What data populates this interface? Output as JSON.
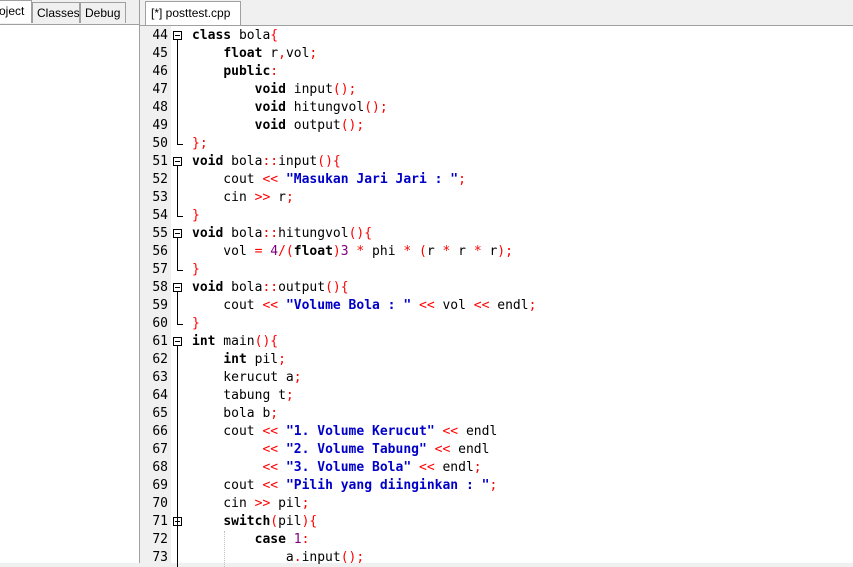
{
  "left_panel": {
    "tabs": [
      {
        "label": "oject",
        "active": true
      },
      {
        "label": "Classes",
        "active": false
      },
      {
        "label": "Debug",
        "active": false
      }
    ]
  },
  "editor": {
    "tab_label": "[*] posttest.cpp",
    "lines": [
      {
        "n": "44",
        "fold": "open",
        "tokens": [
          [
            "kw",
            "class"
          ],
          [
            "t",
            " bola"
          ],
          [
            "s",
            "{"
          ]
        ]
      },
      {
        "n": "45",
        "tokens": [
          [
            "t",
            "    "
          ],
          [
            "kw",
            "float"
          ],
          [
            "t",
            " r"
          ],
          [
            "s",
            ","
          ],
          [
            "t",
            "vol"
          ],
          [
            "s",
            ";"
          ]
        ]
      },
      {
        "n": "46",
        "tokens": [
          [
            "t",
            "    "
          ],
          [
            "kw",
            "public"
          ],
          [
            "s",
            ":"
          ]
        ]
      },
      {
        "n": "47",
        "tokens": [
          [
            "t",
            "        "
          ],
          [
            "kw",
            "void"
          ],
          [
            "t",
            " input"
          ],
          [
            "s",
            "();"
          ]
        ]
      },
      {
        "n": "48",
        "tokens": [
          [
            "t",
            "        "
          ],
          [
            "kw",
            "void"
          ],
          [
            "t",
            " hitungvol"
          ],
          [
            "s",
            "();"
          ]
        ]
      },
      {
        "n": "49",
        "tokens": [
          [
            "t",
            "        "
          ],
          [
            "kw",
            "void"
          ],
          [
            "t",
            " output"
          ],
          [
            "s",
            "();"
          ]
        ]
      },
      {
        "n": "50",
        "fold": "end",
        "tokens": [
          [
            "s",
            "};"
          ]
        ]
      },
      {
        "n": "51",
        "fold": "open",
        "tokens": [
          [
            "kw",
            "void"
          ],
          [
            "t",
            " bola"
          ],
          [
            "s",
            "::"
          ],
          [
            "t",
            "input"
          ],
          [
            "s",
            "(){"
          ]
        ]
      },
      {
        "n": "52",
        "tokens": [
          [
            "t",
            "    cout "
          ],
          [
            "s",
            "<<"
          ],
          [
            "t",
            " "
          ],
          [
            "str",
            "\"Masukan Jari Jari : \""
          ],
          [
            "s",
            ";"
          ]
        ]
      },
      {
        "n": "53",
        "tokens": [
          [
            "t",
            "    cin "
          ],
          [
            "s",
            ">>"
          ],
          [
            "t",
            " r"
          ],
          [
            "s",
            ";"
          ]
        ]
      },
      {
        "n": "54",
        "fold": "end",
        "tokens": [
          [
            "s",
            "}"
          ]
        ]
      },
      {
        "n": "55",
        "fold": "open",
        "tokens": [
          [
            "kw",
            "void"
          ],
          [
            "t",
            " bola"
          ],
          [
            "s",
            "::"
          ],
          [
            "t",
            "hitungvol"
          ],
          [
            "s",
            "(){"
          ]
        ]
      },
      {
        "n": "56",
        "tokens": [
          [
            "t",
            "    vol "
          ],
          [
            "s",
            "="
          ],
          [
            "t",
            " "
          ],
          [
            "num",
            "4"
          ],
          [
            "s",
            "/("
          ],
          [
            "kw",
            "float"
          ],
          [
            "s",
            ")"
          ],
          [
            "num",
            "3"
          ],
          [
            "t",
            " "
          ],
          [
            "s",
            "*"
          ],
          [
            "t",
            " phi "
          ],
          [
            "s",
            "*"
          ],
          [
            "t",
            " "
          ],
          [
            "s",
            "("
          ],
          [
            "t",
            "r "
          ],
          [
            "s",
            "*"
          ],
          [
            "t",
            " r "
          ],
          [
            "s",
            "*"
          ],
          [
            "t",
            " r"
          ],
          [
            "s",
            ");"
          ]
        ]
      },
      {
        "n": "57",
        "fold": "end",
        "tokens": [
          [
            "s",
            "}"
          ]
        ]
      },
      {
        "n": "58",
        "fold": "open",
        "tokens": [
          [
            "kw",
            "void"
          ],
          [
            "t",
            " bola"
          ],
          [
            "s",
            "::"
          ],
          [
            "t",
            "output"
          ],
          [
            "s",
            "(){"
          ]
        ]
      },
      {
        "n": "59",
        "tokens": [
          [
            "t",
            "    cout "
          ],
          [
            "s",
            "<<"
          ],
          [
            "t",
            " "
          ],
          [
            "str",
            "\"Volume Bola : \""
          ],
          [
            "t",
            " "
          ],
          [
            "s",
            "<<"
          ],
          [
            "t",
            " vol "
          ],
          [
            "s",
            "<<"
          ],
          [
            "t",
            " endl"
          ],
          [
            "s",
            ";"
          ]
        ]
      },
      {
        "n": "60",
        "fold": "end",
        "tokens": [
          [
            "s",
            "}"
          ]
        ]
      },
      {
        "n": "61",
        "fold": "open",
        "tokens": [
          [
            "kw",
            "int"
          ],
          [
            "t",
            " main"
          ],
          [
            "s",
            "(){"
          ]
        ]
      },
      {
        "n": "62",
        "tokens": [
          [
            "t",
            "    "
          ],
          [
            "kw",
            "int"
          ],
          [
            "t",
            " pil"
          ],
          [
            "s",
            ";"
          ]
        ]
      },
      {
        "n": "63",
        "tokens": [
          [
            "t",
            "    kerucut a"
          ],
          [
            "s",
            ";"
          ]
        ]
      },
      {
        "n": "64",
        "tokens": [
          [
            "t",
            "    tabung t"
          ],
          [
            "s",
            ";"
          ]
        ]
      },
      {
        "n": "65",
        "tokens": [
          [
            "t",
            "    bola b"
          ],
          [
            "s",
            ";"
          ]
        ]
      },
      {
        "n": "66",
        "tokens": [
          [
            "t",
            "    cout "
          ],
          [
            "s",
            "<<"
          ],
          [
            "t",
            " "
          ],
          [
            "str",
            "\"1. Volume Kerucut\""
          ],
          [
            "t",
            " "
          ],
          [
            "s",
            "<<"
          ],
          [
            "t",
            " endl"
          ]
        ]
      },
      {
        "n": "67",
        "tokens": [
          [
            "t",
            "         "
          ],
          [
            "s",
            "<<"
          ],
          [
            "t",
            " "
          ],
          [
            "str",
            "\"2. Volume Tabung\""
          ],
          [
            "t",
            " "
          ],
          [
            "s",
            "<<"
          ],
          [
            "t",
            " endl"
          ]
        ]
      },
      {
        "n": "68",
        "tokens": [
          [
            "t",
            "         "
          ],
          [
            "s",
            "<<"
          ],
          [
            "t",
            " "
          ],
          [
            "str",
            "\"3. Volume Bola\""
          ],
          [
            "t",
            " "
          ],
          [
            "s",
            "<<"
          ],
          [
            "t",
            " endl"
          ],
          [
            "s",
            ";"
          ]
        ]
      },
      {
        "n": "69",
        "tokens": [
          [
            "t",
            "    cout "
          ],
          [
            "s",
            "<<"
          ],
          [
            "t",
            " "
          ],
          [
            "str",
            "\"Pilih yang diinginkan : \""
          ],
          [
            "s",
            ";"
          ]
        ]
      },
      {
        "n": "70",
        "tokens": [
          [
            "t",
            "    cin "
          ],
          [
            "s",
            ">>"
          ],
          [
            "t",
            " pil"
          ],
          [
            "s",
            ";"
          ]
        ]
      },
      {
        "n": "71",
        "fold": "open",
        "tokens": [
          [
            "t",
            "    "
          ],
          [
            "kw",
            "switch"
          ],
          [
            "s",
            "("
          ],
          [
            "t",
            "pil"
          ],
          [
            "s",
            "){"
          ]
        ]
      },
      {
        "n": "72",
        "tokens": [
          [
            "t",
            "        "
          ],
          [
            "kw",
            "case"
          ],
          [
            "t",
            " "
          ],
          [
            "num",
            "1"
          ],
          [
            "s",
            ":"
          ]
        ]
      },
      {
        "n": "73",
        "tokens": [
          [
            "t",
            "            a"
          ],
          [
            "s",
            "."
          ],
          [
            "t",
            "input"
          ],
          [
            "s",
            "();"
          ]
        ]
      }
    ]
  },
  "colors": {
    "keyword": "#000000",
    "string": "#0000c8",
    "symbol": "#ff0000",
    "number": "#800080",
    "gutter_bg": "#f0f0f0"
  }
}
